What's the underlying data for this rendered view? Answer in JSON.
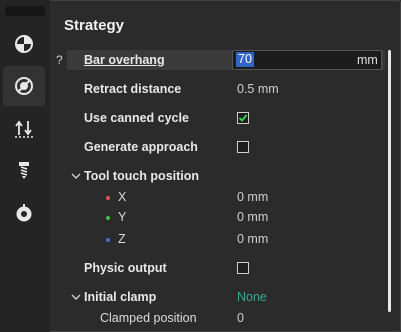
{
  "panel": {
    "title": "Strategy"
  },
  "sidebar": {
    "items": [
      {
        "icon": "pie-chart-icon",
        "active": false
      },
      {
        "icon": "no-cut-icon",
        "active": true
      },
      {
        "icon": "retract-arrows-icon",
        "active": false
      },
      {
        "icon": "drill-tool-icon",
        "active": false
      },
      {
        "icon": "spindle-icon",
        "active": false
      }
    ]
  },
  "help_mark": "?",
  "fields": {
    "bar_overhang": {
      "label": "Bar overhang",
      "value": "70",
      "unit": "mm"
    },
    "retract_distance": {
      "label": "Retract distance",
      "value": "0.5 mm"
    },
    "use_canned_cycle": {
      "label": "Use canned cycle",
      "checked": true
    },
    "generate_approach": {
      "label": "Generate approach",
      "checked": false
    },
    "tool_touch_position": {
      "label": "Tool touch position",
      "x": {
        "label": "X",
        "value": "0 mm",
        "color": "#e05050"
      },
      "y": {
        "label": "Y",
        "value": "0 mm",
        "color": "#3fbf3f"
      },
      "z": {
        "label": "Z",
        "value": "0 mm",
        "color": "#4a6fe0"
      }
    },
    "physic_output": {
      "label": "Physic output",
      "checked": false
    },
    "initial_clamp": {
      "label": "Initial clamp",
      "value": "None",
      "value_color": "#3aa89a"
    },
    "clamped_position": {
      "label": "Clamped position",
      "value": "0"
    }
  }
}
